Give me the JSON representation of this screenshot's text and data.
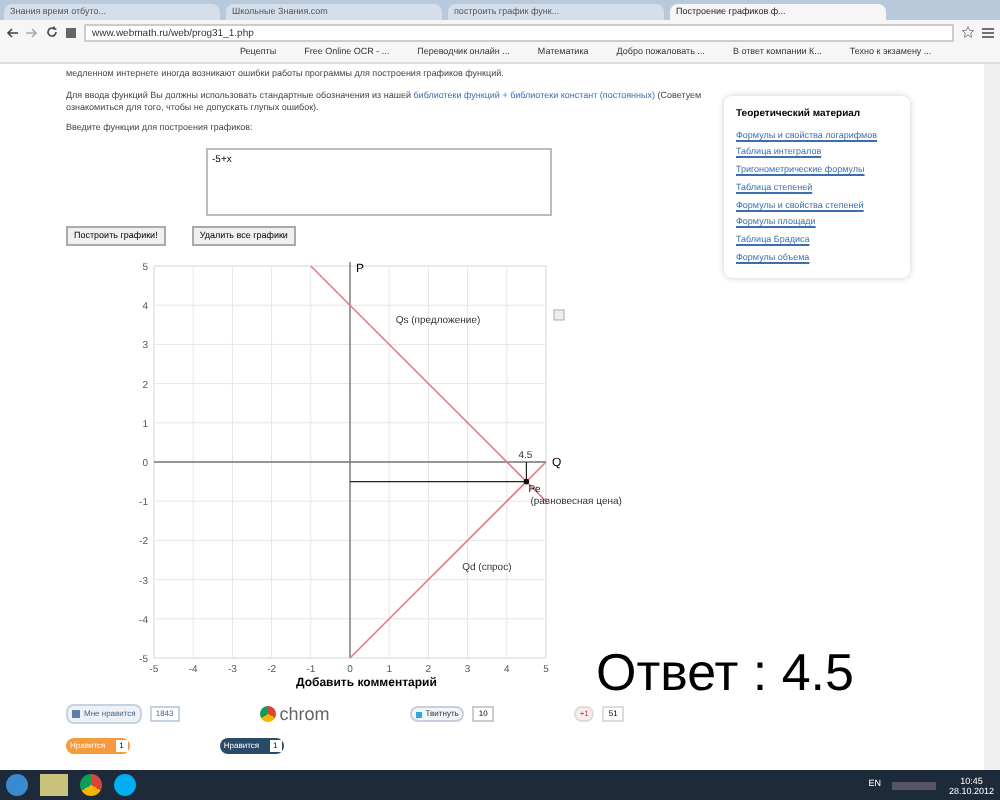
{
  "browser": {
    "tabs": [
      {
        "label": "Знания время отбуто...",
        "selected": false
      },
      {
        "label": "Школьные Знания.com",
        "selected": false
      },
      {
        "label": "построить график функ...",
        "selected": false
      },
      {
        "label": "Построение графиков ф...",
        "selected": true
      }
    ],
    "url": "www.webmath.ru/web/prog31_1.php",
    "bookmarks": [
      "Рецепты",
      "Free Online OCR - ...",
      "Переводчик онлайн ...",
      "Математика",
      "Добро пожаловать ...",
      "В ответ компании К...",
      "Техно к экзамену ..."
    ]
  },
  "page": {
    "intro_tail": "медленном интернете иногда возникают ошибки работы программы для построения графиков функций.",
    "instructions": {
      "before": "Для ввода функций Вы должны использовать стандартные обозначения из нашей",
      "link": "библиотеки функций + библиотеки констант (постоянных)",
      "after": "(Советуем ознакомиться для того, чтобы не допускать глупых ошибок)."
    },
    "input_label": "Введите функции для построения графиков:",
    "function_input": {
      "value": "-5+x"
    },
    "buttons": [
      "Построить графики!",
      "Удалить все графики"
    ],
    "chart": {
      "chart_data": {
        "type": "line",
        "x": [
          -1,
          0,
          4.5,
          5
        ],
        "series": [
          {
            "name": "Qs (предложение)",
            "color": "#e07a8a",
            "values": [
              5,
              4,
              -0.5,
              -1
            ]
          },
          {
            "name": "Qd (спрос)",
            "color": "#e07a8a",
            "values": [
              null,
              -5,
              -0.5,
              0
            ]
          }
        ],
        "xlim": [
          -5,
          5
        ],
        "ylim": [
          -5,
          5
        ],
        "xticks": [
          -5,
          -4,
          -3,
          -2,
          -1,
          0,
          1,
          2,
          3,
          4,
          5
        ],
        "yticks": [
          -5,
          -4,
          -3,
          -2,
          -1,
          0,
          1,
          2,
          3,
          4,
          5
        ],
        "xlabel": "Q",
        "ylabel": "P",
        "grid": true,
        "annotations": [
          "4.5",
          {
            "x": 4.5,
            "y": -0.5,
            "text": "Pe"
          },
          "(равновесная цена)"
        ]
      }
    },
    "answer": "Ответ : 4.5",
    "comments_title": "Добавить комментарий",
    "social": [
      {
        "kind": "vk",
        "label": "Мне нравится",
        "count": "1843"
      },
      {
        "kind": "chrome",
        "label": "chrom"
      },
      {
        "kind": "twitter",
        "label": "Твитнуть",
        "count": "10"
      },
      {
        "kind": "gplus",
        "label": "+1",
        "count": "51"
      },
      {
        "kind": "ok",
        "label": "Нравится",
        "count": "1"
      },
      {
        "kind": "fb",
        "label": "Нравится",
        "count": "1"
      }
    ],
    "sidebar": {
      "title": "Теоретический материал",
      "links": [
        "Формулы и свойства логарифмов",
        "Таблица интегралов",
        "Тригонометрические формулы",
        "Таблица степеней",
        "Формулы и свойства степеней",
        "Формулы площади",
        "Таблица Брадиса",
        "Формулы объема"
      ]
    }
  },
  "taskbar": {
    "language": "EN",
    "time": "10:45",
    "date": "28.10.2012"
  }
}
